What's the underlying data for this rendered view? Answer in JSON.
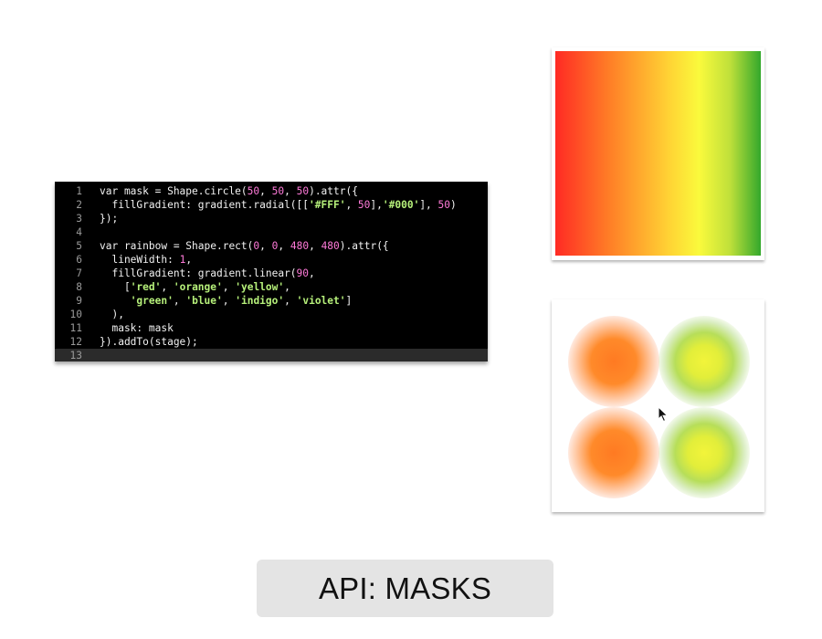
{
  "slide": {
    "title": "API: MASKS"
  },
  "code": {
    "lines": [
      {
        "num": "1",
        "text": "var mask = Shape.circle(50, 50, 50).attr({"
      },
      {
        "num": "2",
        "text": "  fillGradient: gradient.radial([['#FFF', 50],'#000'], 50)"
      },
      {
        "num": "3",
        "text": "});"
      },
      {
        "num": "4",
        "text": ""
      },
      {
        "num": "5",
        "text": "var rainbow = Shape.rect(0, 0, 480, 480).attr({"
      },
      {
        "num": "6",
        "text": "  lineWidth: 1,"
      },
      {
        "num": "7",
        "text": "  fillGradient: gradient.linear(90,"
      },
      {
        "num": "8",
        "text": "    ['red', 'orange', 'yellow',"
      },
      {
        "num": "9",
        "text": "     'green', 'blue', 'indigo', 'violet']"
      },
      {
        "num": "10",
        "text": "  ),"
      },
      {
        "num": "11",
        "text": "  mask: mask"
      },
      {
        "num": "12",
        "text": "}).addTo(stage);"
      },
      {
        "num": "13",
        "text": ""
      }
    ],
    "current_line": "13"
  },
  "previews": {
    "rainbow_colors": [
      "#ff2a24",
      "#ff7a26",
      "#ffd234",
      "#fafa3c",
      "#bfe03a",
      "#33a82c"
    ],
    "mask_blob_colors": {
      "left_column": "#ff7a22",
      "right_column": "#e2ee3a"
    }
  },
  "colors": {
    "editor_background": "#000000",
    "number_token": "#ff7ad9",
    "string_token": "#b6f07a",
    "banner_background": "#e4e4e4"
  },
  "icons": {
    "cursor": "mouse-pointer-icon"
  }
}
